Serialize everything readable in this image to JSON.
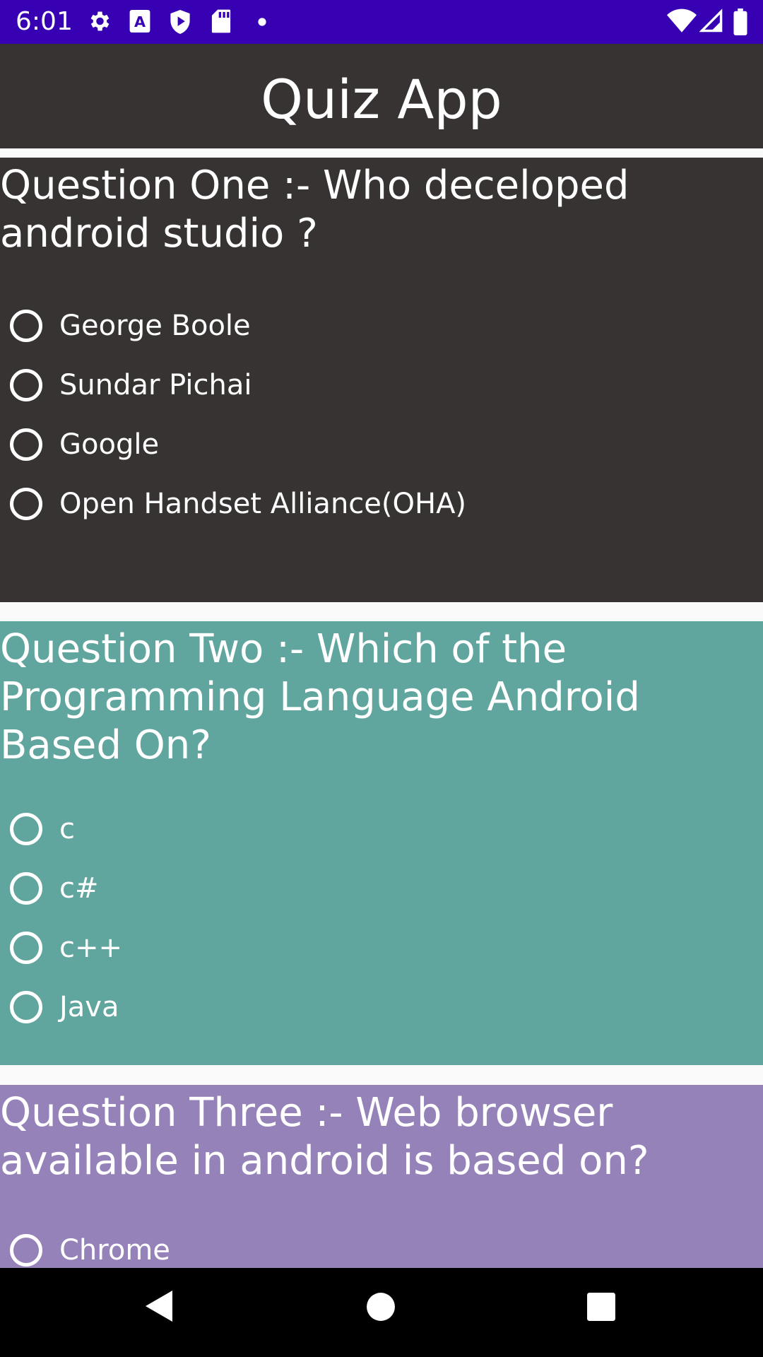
{
  "status_bar": {
    "time": "6:01",
    "icons": [
      "settings-icon",
      "text-a-icon",
      "shield-play-icon",
      "sd-card-icon",
      "dot-icon",
      "wifi-icon",
      "signal-icon",
      "battery-icon"
    ]
  },
  "app_bar": {
    "title": "Quiz App"
  },
  "questions": [
    {
      "text": "Question One :- Who deceloped android studio ?",
      "color": "#383333",
      "options": [
        "George Boole",
        "Sundar Pichai",
        "Google",
        "Open Handset Alliance(OHA)"
      ]
    },
    {
      "text": "Question Two :- Which of the Programming Language Android Based On?",
      "color": "#60a69e",
      "options": [
        "c",
        "c#",
        "c++",
        "Java"
      ]
    },
    {
      "text": "Question Three :- Web browser available in android is based on?",
      "color": "#9582b9",
      "options": [
        "Chrome"
      ]
    }
  ],
  "nav_bar": {
    "buttons": [
      "back-icon",
      "home-icon",
      "recents-icon"
    ]
  }
}
